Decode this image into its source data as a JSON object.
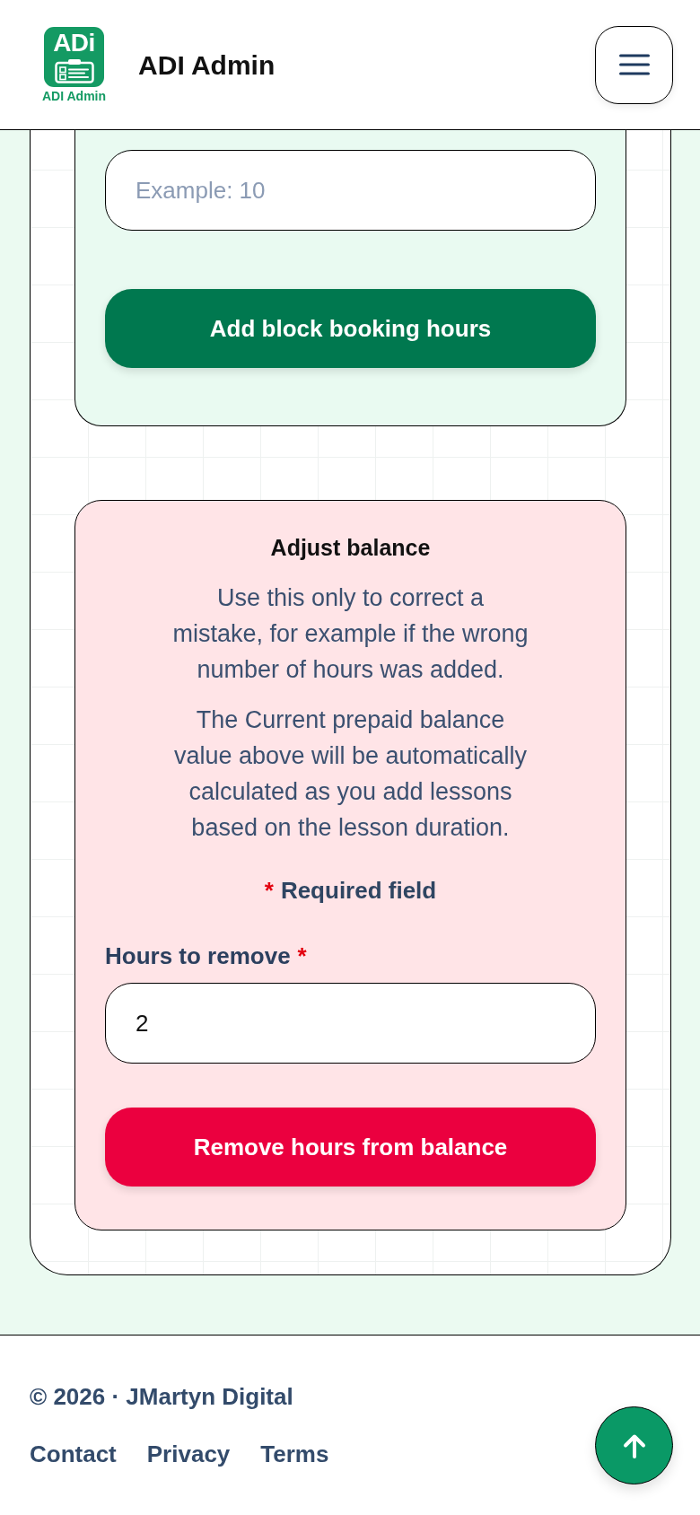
{
  "header": {
    "logo": {
      "mark": "ADi",
      "caption": "ADI Admin"
    },
    "title": "ADI Admin"
  },
  "block_booking": {
    "hours_field": {
      "placeholder": "Example: 10"
    },
    "button": "Add block booking hours"
  },
  "adjust_balance": {
    "title": "Adjust balance",
    "paragraphs": [
      "Use this only to correct a mistake, for example if the wrong number of hours was added.",
      "The Current prepaid balance value above will be automatically calculated as you add lessons based on the lesson duration."
    ],
    "required_note": {
      "marker": "*",
      "text": "Required field"
    },
    "hours_field": {
      "label": "Hours to remove",
      "required_marker": "*",
      "value": "2"
    },
    "button": "Remove hours from balance"
  },
  "footer": {
    "copyright": "© 2026 · JMartyn Digital",
    "links": [
      "Contact",
      "Privacy",
      "Terms"
    ]
  }
}
